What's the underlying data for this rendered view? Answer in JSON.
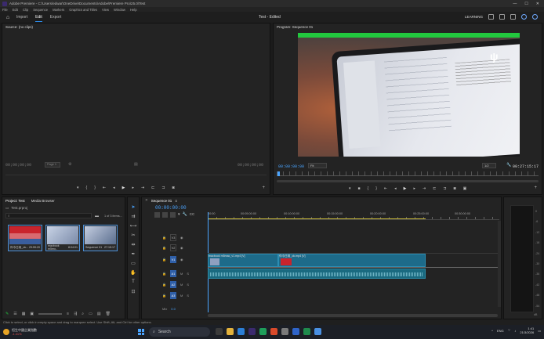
{
  "window": {
    "title": "Adobe Premiere - C:\\Users\\edwar\\OneDrive\\Documents\\Adobe\\Premiere Pro\\25.0\\Test"
  },
  "menu": [
    "File",
    "Edit",
    "Clip",
    "Sequence",
    "Markers",
    "Graphics and Titles",
    "View",
    "Window",
    "Help"
  ],
  "workspace": {
    "tabs": [
      "Import",
      "Edit",
      "Export"
    ],
    "active_tab": "Edit",
    "project_title": "Test - Edited",
    "learning_label": "LEARNING"
  },
  "source": {
    "title": "Source: (no clips)",
    "tc_in": "00;00;00;00",
    "tc_out": "00;00;00;00",
    "page_label": "Page 1"
  },
  "program": {
    "title": "Program: Sequence 01",
    "tc_current": "00:00:00:00",
    "fit_label": "Fit",
    "quality_label": "1/2",
    "tc_duration": "00:27:15:17"
  },
  "project": {
    "title": "Project: Test",
    "browser_tab": "Media Browser",
    "bin_name": "Test.prproj",
    "items_count": "1 of 3 items...",
    "items": [
      {
        "name": "你今日用_ok...",
        "duration": "29:59:20",
        "color": "#c9242d"
      },
      {
        "name": "macbook m5mo..",
        "duration": "8:04:01",
        "color": "#7a8aa8"
      },
      {
        "name": "Sequence 01",
        "duration": "27:15:17",
        "color": "#5a6e8e"
      }
    ]
  },
  "tools": [
    "selection",
    "track-select",
    "ripple",
    "razor",
    "slip",
    "pen",
    "rectangle",
    "hand",
    "type"
  ],
  "timeline": {
    "tab": "Sequence 01",
    "timecode": "00:00:00:00",
    "ruler": [
      "00:00",
      "00:05:00:00",
      "00:10:00:00",
      "00:15:00:00",
      "00:20:00:00",
      "00:25:00:00",
      "00:30:00:00"
    ],
    "video_tracks": [
      "V3",
      "V2",
      "V1"
    ],
    "audio_tracks": [
      "A1",
      "A2",
      "A3"
    ],
    "mix_label": "Mix",
    "mix_value": "0.0",
    "clips": [
      {
        "name": "macbook m5mac_v1.mp4 [V]",
        "track": "V1",
        "start": 0,
        "end": 0.38
      },
      {
        "name": "你今日用_ok.mp4 [V]",
        "track": "V1",
        "start": 0.38,
        "end": 1.0
      }
    ]
  },
  "meter": {
    "scale": [
      "0",
      "-6",
      "-12",
      "-18",
      "-24",
      "-30",
      "-36",
      "-42",
      "-48",
      "-54"
    ],
    "unit_label": "dB"
  },
  "status": {
    "hint": "Click to select, or click in empty space and drag to marquee select. Use Shift, Alt, and Ctrl for other options."
  },
  "taskbar": {
    "weather_temp": "恒生中國企業指數",
    "weather_change": "-1.41%",
    "search_placeholder": "Search",
    "time": "1:41",
    "date": "21/3/2026",
    "lang": "ENG"
  },
  "colors": {
    "accent": "#2d8ceb",
    "clip_video": "#1d6b8a",
    "clip_audio": "#1a6a80",
    "selection_green": "#22c83e"
  }
}
